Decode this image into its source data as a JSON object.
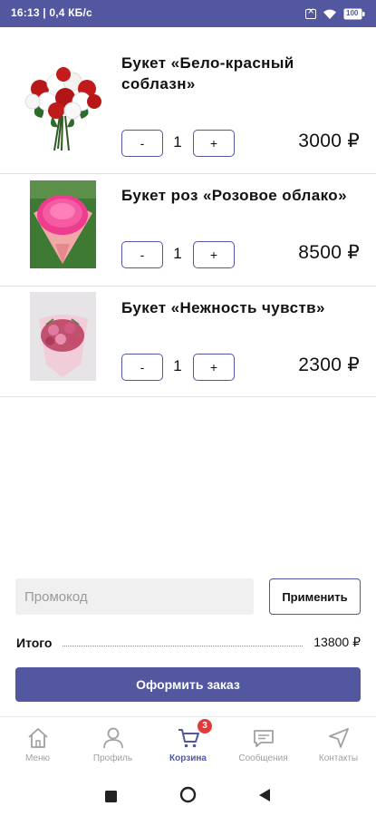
{
  "status_bar": {
    "left_text": "16:13 | 0,4 КБ/с",
    "battery": "100"
  },
  "cart": {
    "items": [
      {
        "title": "Букет «Бело-красный соблазн»",
        "qty": "1",
        "price": "3000 ₽",
        "minus": "-",
        "plus": "+"
      },
      {
        "title": "Букет  роз «Розовое облако»",
        "qty": "1",
        "price": "8500 ₽",
        "minus": "-",
        "plus": "+"
      },
      {
        "title": "Букет «Нежность чувств»",
        "qty": "1",
        "price": "2300 ₽",
        "minus": "-",
        "plus": "+"
      }
    ]
  },
  "promo": {
    "placeholder": "Промокод",
    "apply_label": "Применить"
  },
  "total": {
    "label": "Итого",
    "value": "13800 ₽"
  },
  "checkout": {
    "label": "Оформить заказ"
  },
  "bottom_nav": {
    "items": [
      {
        "label": "Меню",
        "icon": "home-icon"
      },
      {
        "label": "Профиль",
        "icon": "user-icon"
      },
      {
        "label": "Корзина",
        "icon": "cart-icon",
        "badge": "3",
        "active": true
      },
      {
        "label": "Сообщения",
        "icon": "chat-icon"
      },
      {
        "label": "Контакты",
        "icon": "navigation-icon"
      }
    ]
  },
  "colors": {
    "accent": "#5257a0",
    "badge": "#e03a3a"
  }
}
